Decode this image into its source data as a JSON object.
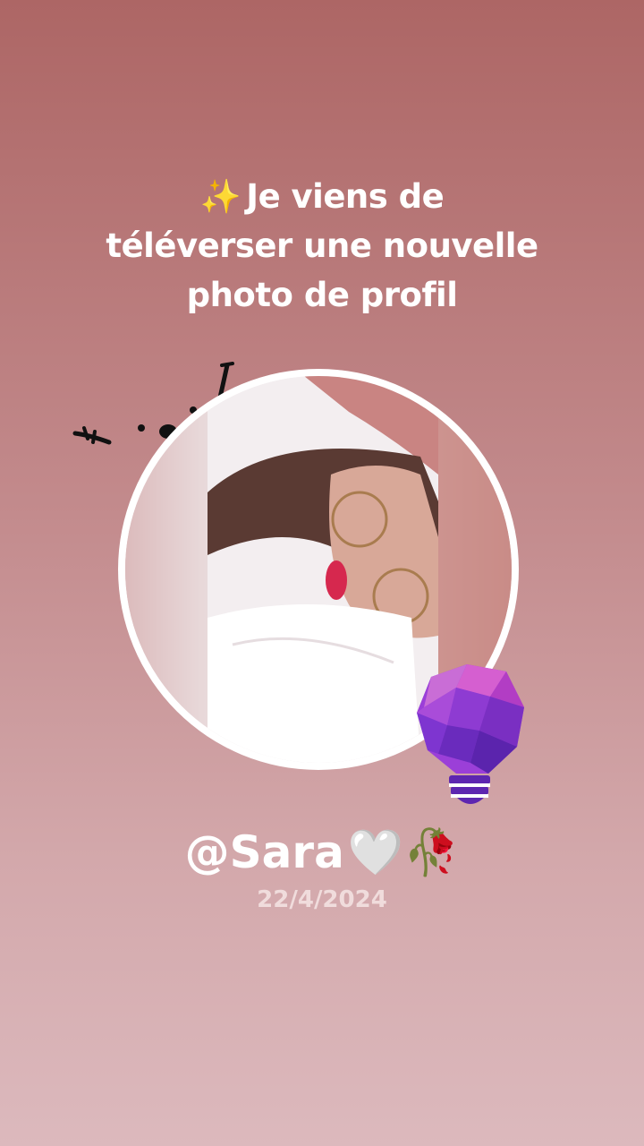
{
  "headline": {
    "icon": "sparkles-icon",
    "sparkle": "✨",
    "line1": "Je viens de",
    "line2": "téléverser une nouvelle",
    "line3": "photo de profil"
  },
  "profile": {
    "username": "@Sara",
    "heart": "🤍",
    "rose": "🥀",
    "date": "22/4/2024"
  },
  "colors": {
    "background_top": "#ad6665",
    "background_bottom": "#dcb9bd",
    "text": "#ffffff",
    "bulb_primary": "#9b3fd8",
    "bulb_secondary": "#c54fc9"
  }
}
